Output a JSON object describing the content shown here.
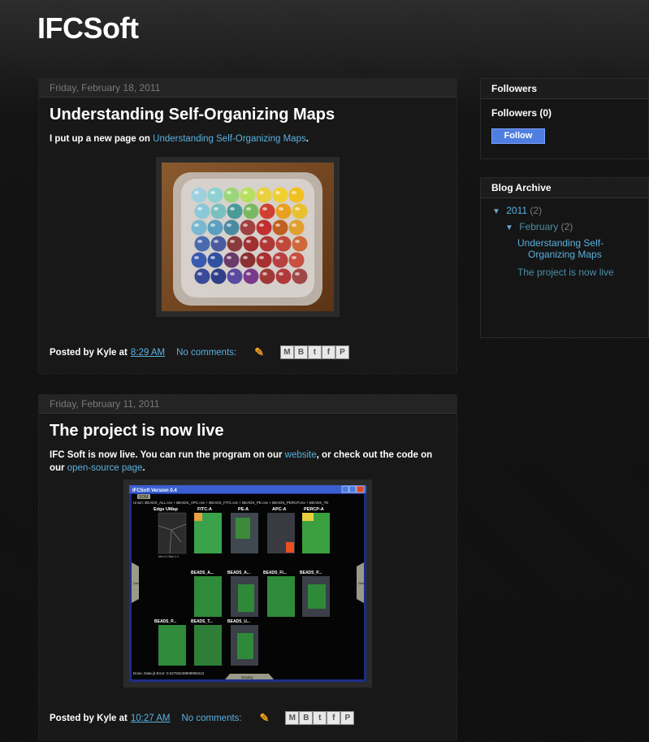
{
  "blog": {
    "title": "IFCSoft"
  },
  "posts": [
    {
      "date": "Friday, February 18, 2011",
      "title": "Understanding Self-Organizing Maps",
      "body_prefix": "I put up a new page on ",
      "body_link": "Understanding Self-Organizing Maps",
      "body_suffix": ".",
      "posted_by_label": "Posted by Kyle at ",
      "time": "8:29 AM",
      "comments": "No comments:"
    },
    {
      "date": "Friday, February 11, 2011",
      "title": "The project is now live",
      "body_prefix": "IFC Soft is now live. You can run the program on our ",
      "body_link1": "website",
      "body_middle": ", or check out the code on our ",
      "body_link2": "open-source page",
      "body_suffix": ".",
      "posted_by_label": "Posted by Kyle at ",
      "time": "10:27 AM",
      "comments": "No comments:",
      "screenshot": {
        "window_title": "IFCSoft Version 0.4",
        "tab": "SOM",
        "union_text": "Union: BEADS_ALL.csv + BEADS_APC.csv + BEADS_FITC.csv + BEADS_PE.csv + BEADS_PERCP.csv + BEADS_TE",
        "edge_label": "Edge UMap",
        "edge_caption": "Min:0.0 Max:1.0",
        "cols": [
          "FITC-A",
          "PE-A",
          "APC-A",
          "PERCP-A"
        ],
        "row2": [
          "BEADS_A...",
          "BEADS_A...",
          "BEADS_FI...",
          "BEADS_P..."
        ],
        "row3": [
          "BEADS_P...",
          "BEADS_T...",
          "BEADS_U..."
        ],
        "status": "Done. Data jit Error: 0.02783248908906212",
        "bottom_tab": "Display",
        "side_left": "Data",
        "side_right": "Data"
      }
    }
  ],
  "sidebar": {
    "followers": {
      "title": "Followers",
      "count_label": "Followers (0)",
      "follow_button": "Follow"
    },
    "archive": {
      "title": "Blog Archive",
      "year": "2011",
      "year_count": "(2)",
      "month": "February",
      "month_count": "(2)",
      "posts": [
        "Understanding Self-Organizing Maps",
        "The project is now live"
      ]
    }
  },
  "icons": {
    "pencil": "pencil-icon",
    "share": [
      "email-icon",
      "blogger-icon",
      "twitter-icon",
      "facebook-icon",
      "pinterest-icon"
    ]
  },
  "colors": {
    "link": "#5ab1e0",
    "follow_button": "#4e7fe0",
    "background": "#0f0f0f"
  }
}
